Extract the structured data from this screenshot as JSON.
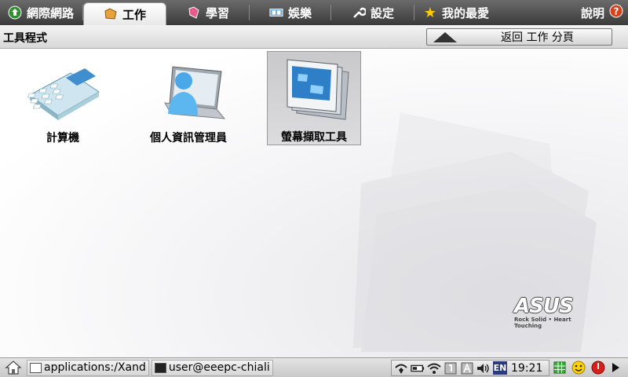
{
  "tabs": [
    {
      "label": "網際網路",
      "icon": "globe-icon",
      "active": false
    },
    {
      "label": "工作",
      "icon": "folder-icon",
      "active": true
    },
    {
      "label": "學習",
      "icon": "book-icon",
      "active": false
    },
    {
      "label": "娛樂",
      "icon": "film-icon",
      "active": false
    },
    {
      "label": "設定",
      "icon": "wrench-icon",
      "active": false
    },
    {
      "label": "我的最愛",
      "icon": "star-icon",
      "active": false
    }
  ],
  "help": {
    "label": "說明",
    "icon": "help-icon"
  },
  "section": {
    "title": "工具程式",
    "back_label": "返回 工作 分頁"
  },
  "apps": [
    {
      "label": "計算機",
      "icon": "calculator-icon"
    },
    {
      "label": "個人資訊管理員",
      "icon": "pim-icon"
    },
    {
      "label": "螢幕擷取工具",
      "icon": "screen-capture-icon",
      "selected": true
    }
  ],
  "brand": {
    "logo": "ASUS",
    "tagline": "Rock Solid • Heart Touching"
  },
  "taskbar": {
    "tasks": [
      {
        "label": "applications:/Xand",
        "icon": "window-icon"
      },
      {
        "label": "user@eeepc-chiali",
        "icon": "terminal-icon"
      }
    ],
    "tray": {
      "lang": "EN",
      "time": "19:21"
    }
  },
  "colors": {
    "tabbar": "#4a4a4a",
    "active_tab": "#ffffff",
    "selected_app": "#cfcfd2"
  }
}
